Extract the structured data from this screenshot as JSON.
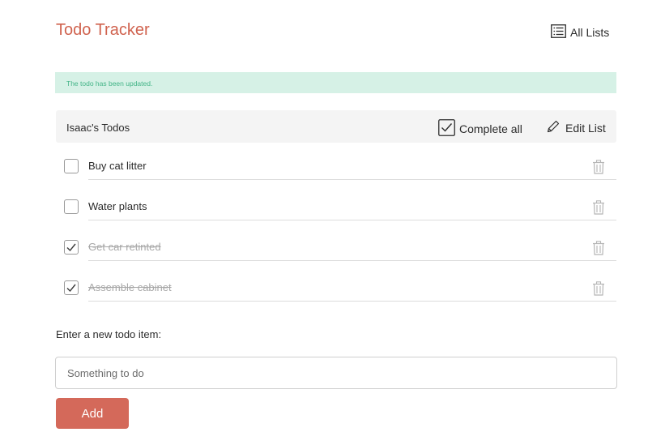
{
  "app": {
    "title": "Todo Tracker",
    "all_lists_label": "All Lists"
  },
  "flash": {
    "message": "The todo has been updated."
  },
  "list": {
    "name": "Isaac's Todos",
    "complete_all_label": "Complete all",
    "edit_list_label": "Edit List",
    "todos": [
      {
        "title": "Buy cat litter",
        "done": false
      },
      {
        "title": "Water plants",
        "done": false
      },
      {
        "title": "Get car retinted",
        "done": true
      },
      {
        "title": "Assemble cabinet",
        "done": true
      }
    ]
  },
  "new_todo": {
    "label": "Enter a new todo item:",
    "placeholder": "Something to do",
    "value": "",
    "add_label": "Add"
  },
  "colors": {
    "brand": "#d0634f",
    "flash_bg": "#d6f1e6",
    "flash_text": "#43b487",
    "add_button": "#d4695a"
  },
  "icons": {
    "all_lists": "list-icon",
    "complete_all": "checkbox-checked-icon",
    "edit_list": "pencil-icon",
    "delete": "trash-icon"
  }
}
